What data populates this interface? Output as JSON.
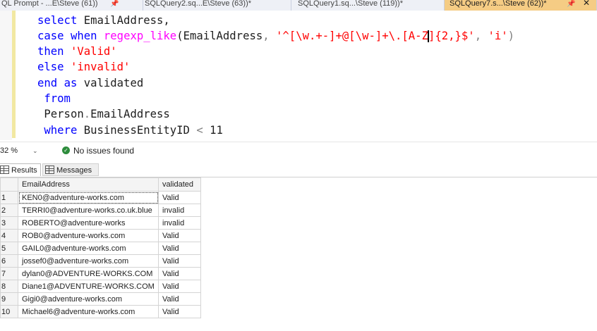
{
  "tabs": [
    {
      "label": "QL Prompt - ...E\\Steve (61))",
      "active": false,
      "pinned": true
    },
    {
      "label": "SQLQuery2.sq...E\\Steve (63))*",
      "active": false,
      "pinned": false
    },
    {
      "label": "SQLQuery1.sq...\\Steve (119))*",
      "active": false,
      "pinned": false
    },
    {
      "label": "SQLQuery7.s...\\Steve (62))*",
      "active": true,
      "pinned": true
    }
  ],
  "editor": {
    "lines": [
      [
        {
          "t": "select",
          "c": "kw"
        },
        {
          "t": " EmailAddress,",
          "c": "id"
        }
      ],
      [
        {
          "t": "case",
          "c": "kw"
        },
        {
          "t": " ",
          "c": "id"
        },
        {
          "t": "when",
          "c": "kw"
        },
        {
          "t": " ",
          "c": "id"
        },
        {
          "t": "regexp_like",
          "c": "fn"
        },
        {
          "t": "(EmailAddress",
          "c": "id"
        },
        {
          "t": ",",
          "c": "op"
        },
        {
          "t": " ",
          "c": "id"
        },
        {
          "t": "'^[\\w.+-]+@[\\w-]+\\.[A-Z",
          "c": "str"
        },
        {
          "t": "",
          "c": "caret"
        },
        {
          "t": "]{2,}$'",
          "c": "str"
        },
        {
          "t": ",",
          "c": "op"
        },
        {
          "t": " ",
          "c": "id"
        },
        {
          "t": "'i'",
          "c": "str"
        },
        {
          "t": ")",
          "c": "op"
        }
      ],
      [
        {
          "t": "then",
          "c": "kw"
        },
        {
          "t": " ",
          "c": "id"
        },
        {
          "t": "'Valid'",
          "c": "str"
        }
      ],
      [
        {
          "t": "else",
          "c": "kw"
        },
        {
          "t": " ",
          "c": "id"
        },
        {
          "t": "'invalid'",
          "c": "str"
        }
      ],
      [
        {
          "t": "end",
          "c": "kw"
        },
        {
          "t": " ",
          "c": "id"
        },
        {
          "t": "as",
          "c": "kw"
        },
        {
          "t": " validated",
          "c": "id"
        }
      ],
      [
        {
          "t": " from",
          "c": "kw"
        }
      ],
      [
        {
          "t": " Person",
          "c": "id"
        },
        {
          "t": ".",
          "c": "op"
        },
        {
          "t": "EmailAddress",
          "c": "id"
        }
      ],
      [
        {
          "t": " where",
          "c": "kw"
        },
        {
          "t": " BusinessEntityID ",
          "c": "id"
        },
        {
          "t": "<",
          "c": "op"
        },
        {
          "t": " 11",
          "c": "id"
        }
      ]
    ]
  },
  "status": {
    "zoom": "32 %",
    "message": "No issues found",
    "colors": {
      "ok": "#2d8c3c"
    }
  },
  "results_tabs": [
    {
      "label": "Results",
      "active": true
    },
    {
      "label": "Messages",
      "active": false
    }
  ],
  "grid": {
    "columns": [
      "EmailAddress",
      "validated"
    ],
    "rows": [
      [
        "1",
        "KEN0@adventure-works.com",
        "Valid"
      ],
      [
        "2",
        "TERRI0@adventure-works.co.uk.blue",
        "invalid"
      ],
      [
        "3",
        "ROBERTO@adventure-works",
        "invalid"
      ],
      [
        "4",
        "ROB0@adventure-works.com",
        "Valid"
      ],
      [
        "5",
        "GAIL0@adventure-works.com",
        "Valid"
      ],
      [
        "6",
        "jossef0@adventure-works.com",
        "Valid"
      ],
      [
        "7",
        "dylan0@ADVENTURE-WORKS.COM",
        "Valid"
      ],
      [
        "8",
        "Diane1@ADVENTURE-WORKS.COM",
        "Valid"
      ],
      [
        "9",
        "Gigi0@adventure-works.com",
        "Valid"
      ],
      [
        "10",
        "Michael6@adventure-works.com",
        "Valid"
      ]
    ]
  }
}
